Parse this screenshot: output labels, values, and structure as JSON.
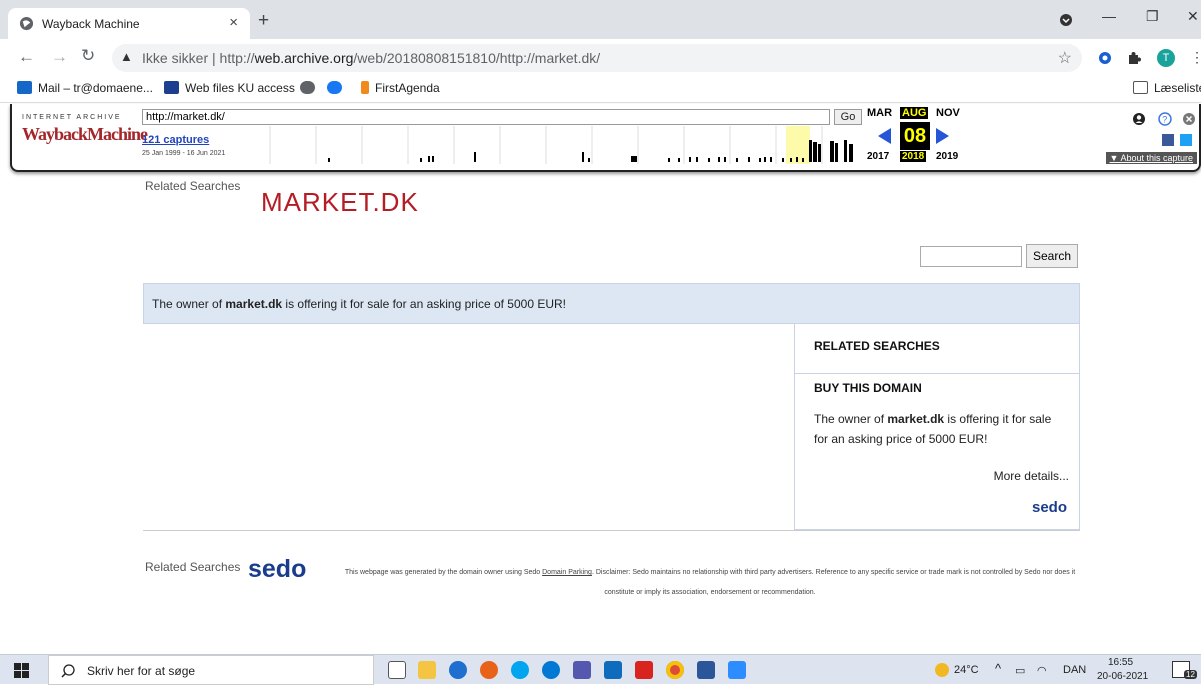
{
  "browser": {
    "tab_title": "Wayback Machine",
    "tab_close": "×",
    "new_tab": "+",
    "address_warning": "Ikke sikker",
    "address_sep": "|",
    "address_url_prefix": "http://",
    "address_url_host": "web.archive.org",
    "address_url_path": "/web/20180808151810/http://market.dk/",
    "bookmarks": [
      "Mail – tr@domaene...",
      "Web files KU access",
      "FirstAgenda"
    ],
    "reading_list": "Læseliste",
    "profile_initial": "T"
  },
  "wayback": {
    "logo_top": "INTERNET ARCHIVE",
    "logo_bottom": "WaybackMachine",
    "url_value": "http://market.dk/",
    "go_label": "Go",
    "captures": "121 captures",
    "range": "25 Jan 1999 - 16 Jun 2021",
    "months": {
      "prev": "MAR",
      "current": "AUG",
      "next": "NOV"
    },
    "day": "08",
    "years": {
      "prev": "2017",
      "current": "2018",
      "next": "2019"
    },
    "about": "▼ About this capture"
  },
  "page": {
    "related_top": "Related Searches",
    "domain_title": "MARKET.DK",
    "search_button": "Search",
    "banner_pre": "The owner of ",
    "banner_domain": "market.dk",
    "banner_post": " is offering it for sale for an asking price of 5000 EUR!",
    "side_related": "RELATED SEARCHES",
    "side_buy": "BUY THIS DOMAIN",
    "side_text_pre": "The owner of ",
    "side_text_domain": "market.dk",
    "side_text_post": " is offering it for sale for an asking price of 5000 EUR!",
    "more_details": "More details...",
    "sedo_small": "sedo",
    "related_bottom": "Related Searches",
    "sedo_big": "sedo",
    "disclaimer_pre": "This webpage was generated by the domain owner using Sedo ",
    "disclaimer_link": "Domain Parking",
    "disclaimer_post": ". Disclaimer: Sedo maintains no relationship with third party advertisers. Reference to any specific service or trade mark is not controlled by Sedo nor does it constitute or imply its association, endorsement or recommendation."
  },
  "taskbar": {
    "search_placeholder": "Skriv her for at søge",
    "weather": "24°C",
    "language": "DAN",
    "time": "16:55",
    "date": "20-06-2021",
    "notifications": "12"
  },
  "colors": {
    "wayback_red": "#a3262a",
    "domain_red": "#b51c24",
    "banner_bg": "#dde7f4",
    "sedo_blue": "#1a3c8c"
  }
}
